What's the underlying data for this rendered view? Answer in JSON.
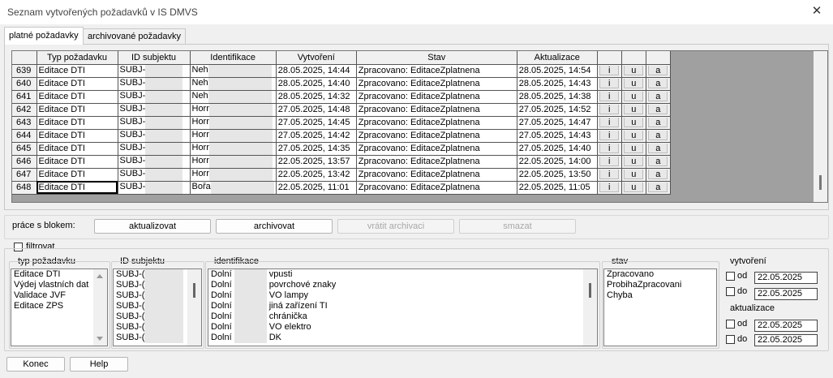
{
  "window": {
    "title": "Seznam vytvořených požadavků v IS DMVS",
    "close": "✕"
  },
  "tabs": [
    {
      "label": "platné požadavky",
      "active": true
    },
    {
      "label": "archivované požadavky",
      "active": false
    }
  ],
  "grid": {
    "headers": [
      "Typ požadavku",
      "ID subjektu",
      "Identifikace",
      "Vytvoření",
      "Stav",
      "Aktualizace"
    ],
    "rows": [
      {
        "num": "639",
        "typ": "Editace DTI",
        "id": "SUBJ-",
        "ident": "Neh",
        "vytvoreni": "28.05.2025, 14:44",
        "stav": "Zpracovano: EditaceZplatnena",
        "aktualizace": "28.05.2025, 14:54"
      },
      {
        "num": "640",
        "typ": "Editace DTI",
        "id": "SUBJ-",
        "ident": "Neh",
        "vytvoreni": "28.05.2025, 14:40",
        "stav": "Zpracovano: EditaceZplatnena",
        "aktualizace": "28.05.2025, 14:43"
      },
      {
        "num": "641",
        "typ": "Editace DTI",
        "id": "SUBJ-",
        "ident": "Neh",
        "vytvoreni": "28.05.2025, 14:32",
        "stav": "Zpracovano: EditaceZplatnena",
        "aktualizace": "28.05.2025, 14:38"
      },
      {
        "num": "642",
        "typ": "Editace DTI",
        "id": "SUBJ-",
        "ident": "Horr",
        "vytvoreni": "27.05.2025, 14:48",
        "stav": "Zpracovano: EditaceZplatnena",
        "aktualizace": "27.05.2025, 14:52"
      },
      {
        "num": "643",
        "typ": "Editace DTI",
        "id": "SUBJ-",
        "ident": "Horr",
        "vytvoreni": "27.05.2025, 14:45",
        "stav": "Zpracovano: EditaceZplatnena",
        "aktualizace": "27.05.2025, 14:47"
      },
      {
        "num": "644",
        "typ": "Editace DTI",
        "id": "SUBJ-",
        "ident": "Horr",
        "vytvoreni": "27.05.2025, 14:42",
        "stav": "Zpracovano: EditaceZplatnena",
        "aktualizace": "27.05.2025, 14:43"
      },
      {
        "num": "645",
        "typ": "Editace DTI",
        "id": "SUBJ-",
        "ident": "Horr",
        "vytvoreni": "27.05.2025, 14:35",
        "stav": "Zpracovano: EditaceZplatnena",
        "aktualizace": "27.05.2025, 14:40"
      },
      {
        "num": "646",
        "typ": "Editace DTI",
        "id": "SUBJ-",
        "ident": "Horr",
        "vytvoreni": "22.05.2025, 13:57",
        "stav": "Zpracovano: EditaceZplatnena",
        "aktualizace": "22.05.2025, 14:00"
      },
      {
        "num": "647",
        "typ": "Editace DTI",
        "id": "SUBJ-",
        "ident": "Horr",
        "vytvoreni": "22.05.2025, 13:42",
        "stav": "Zpracovano: EditaceZplatnena",
        "aktualizace": "22.05.2025, 13:50"
      },
      {
        "num": "648",
        "typ": "Editace DTI",
        "id": "SUBJ-",
        "ident": "Bořa",
        "vytvoreni": "22.05.2025, 11:01",
        "stav": "Zpracovano: EditaceZplatnena",
        "aktualizace": "22.05.2025, 11:05"
      }
    ],
    "action_labels": [
      "i",
      "u",
      "a"
    ]
  },
  "block": {
    "label": "práce s blokem:",
    "buttons": [
      {
        "label": "aktualizovat",
        "enabled": true
      },
      {
        "label": "archivovat",
        "enabled": true
      },
      {
        "label": "vrátit archivaci",
        "enabled": false
      },
      {
        "label": "smazat",
        "enabled": false
      }
    ]
  },
  "filter": {
    "checkbox_label": "filtrovat",
    "checked": false,
    "typ": {
      "label": "typ požadavku",
      "items": [
        "Editace DTI",
        "Výdej vlastních dat",
        "Validace JVF",
        "Editace ZPS"
      ]
    },
    "subjekt": {
      "label": "ID subjektu",
      "items": [
        "SUBJ-(",
        "SUBJ-(",
        "SUBJ-(",
        "SUBJ-(",
        "SUBJ-(",
        "SUBJ-(",
        "SUBJ-("
      ]
    },
    "identifikace": {
      "label": "identifikace",
      "items": [
        {
          "a": "Dolní",
          "b": "vpusti"
        },
        {
          "a": "Dolní",
          "b": "povrchové znaky"
        },
        {
          "a": "Dolní",
          "b": "VO lampy"
        },
        {
          "a": "Dolní",
          "b": "jiná zařízení TI"
        },
        {
          "a": "Dolní",
          "b": "chránička"
        },
        {
          "a": "Dolní",
          "b": "VO elektro"
        },
        {
          "a": "Dolní",
          "b": "DK"
        }
      ]
    },
    "stav": {
      "label": "stav",
      "items": [
        "Zpracovano",
        "ProbihaZpracovani",
        "Chyba"
      ]
    },
    "vytvoreni": {
      "label": "vytvoření",
      "od_label": "od",
      "do_label": "do",
      "od": "22.05.2025",
      "do": "22.05.2025"
    },
    "aktualizace": {
      "label": "aktualizace",
      "od_label": "od",
      "do_label": "do",
      "od": "22.05.2025",
      "do": "22.05.2025"
    }
  },
  "footer": {
    "konec": "Konec",
    "help": "Help"
  }
}
